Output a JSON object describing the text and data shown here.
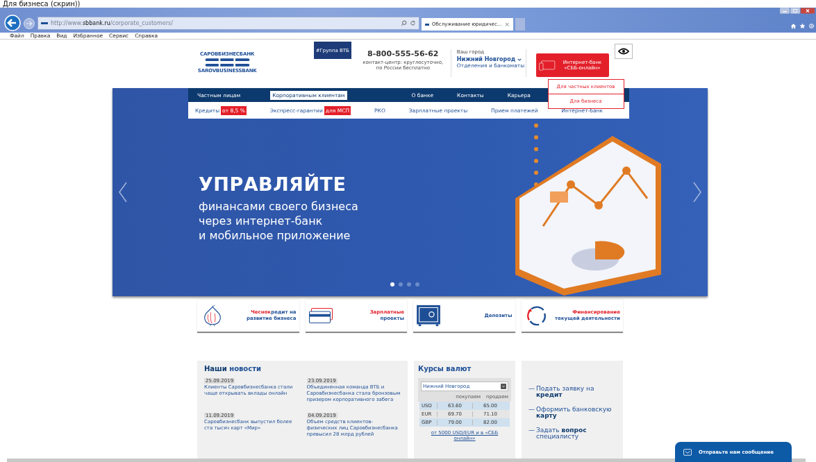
{
  "caption": "Для бизнеса (скрин))",
  "browser": {
    "url": "http://www.**sbbank.ru**/corporate_customers/",
    "tab": "Обслуживание юридичес...",
    "tab_close": "×",
    "menu": [
      "Файл",
      "Правка",
      "Вид",
      "Избранное",
      "Сервис",
      "Справка"
    ]
  },
  "header": {
    "logo_top": "САРОВБИЗНЕСБАНК",
    "logo_bottom": "SAROVBUSINESSBANK",
    "group_badge": "#Группа ВТБ",
    "phone": "8-800-555-56-62",
    "phone_note": "контакт-центр: круглосуточно, по России бесплатно",
    "city_label": "Ваш город",
    "city": "Нижний Новгород",
    "branches": "Отделения и банкоматы",
    "ibank": "Интернет-банк «СББ-онлайн»",
    "dropdown": [
      "Для частных клиентов",
      "Для бизнеса"
    ]
  },
  "nav": [
    {
      "label": "Частным лицам",
      "selected": false
    },
    {
      "label": "Корпоративным клиентам",
      "selected": true
    },
    {
      "label": "О банке",
      "selected": false
    },
    {
      "label": "Контакты",
      "selected": false
    },
    {
      "label": "Карьера",
      "selected": false
    }
  ],
  "subnav": [
    {
      "label": "Кредиты",
      "badge": "от 8,5 %"
    },
    {
      "label": "Экспресс-гарантии",
      "badge": "для МСП"
    },
    {
      "label": "РКО"
    },
    {
      "label": "Зарплатные проекты"
    },
    {
      "label": "Прием платежей"
    },
    {
      "label": "Интернет-банк"
    }
  ],
  "banner": {
    "title": "УПРАВЛЯЙТЕ",
    "lines": [
      "финансами своего бизнеса",
      "через интернет-банк",
      "и мобильное приложение"
    ],
    "dots": [
      {
        "selected": true
      },
      {
        "selected": false
      },
      {
        "selected": false
      },
      {
        "selected": false
      }
    ]
  },
  "tiles": [
    {
      "kind": "onion",
      "accent": "Чеснок",
      "text": "редит на развитие бизнеса"
    },
    {
      "kind": "cards",
      "accent": "Зарплатные",
      "text": "проекты"
    },
    {
      "kind": "safe",
      "text": "Депозиты"
    },
    {
      "kind": "cycle",
      "accent": "Финансирование",
      "text": "текущей деятельности"
    }
  ],
  "news": {
    "title": "**Наши** новости",
    "items": [
      {
        "date": "25.09.2019",
        "text": "Клиенты Саровбизнесбанка стали чаще открывать вклады онлайн"
      },
      {
        "date": "23.09.2019",
        "text": "Объединенная команда ВТБ и Саровбизнесбанка стала бронзовым призером корпоративного забега"
      },
      {
        "date": "11.09.2019",
        "text": "Саровбизнесбанк выпустил более ста тысяч карт «Мир»"
      },
      {
        "date": "04.09.2019",
        "text": "Объем средств клиентов-физических лиц Саровбизнесбанка превысил 28 млрд рублей"
      }
    ]
  },
  "rates": {
    "title": "Курсы валют",
    "city": "Нижний Новгород",
    "headers": [
      "покупаем",
      "продаем"
    ],
    "rows": [
      {
        "currency": "USD",
        "buy": "63.60",
        "sell": "65.00"
      },
      {
        "currency": "EUR",
        "buy": "69.70",
        "sell": "71.10"
      },
      {
        "currency": "GBP",
        "buy": "79.00",
        "sell": "82.00"
      }
    ],
    "link": "от 5000 USD/EUR и в «СББ онлайн»"
  },
  "links": [
    {
      "dash": "—",
      "text": "Подать заявку на **кредит**"
    },
    {
      "dash": "—",
      "text": "Оформить банковскую **карту**"
    },
    {
      "dash": "—",
      "text": "Задать **вопрос** специалисту"
    }
  ],
  "chat": "Отправьте нам сообщение"
}
